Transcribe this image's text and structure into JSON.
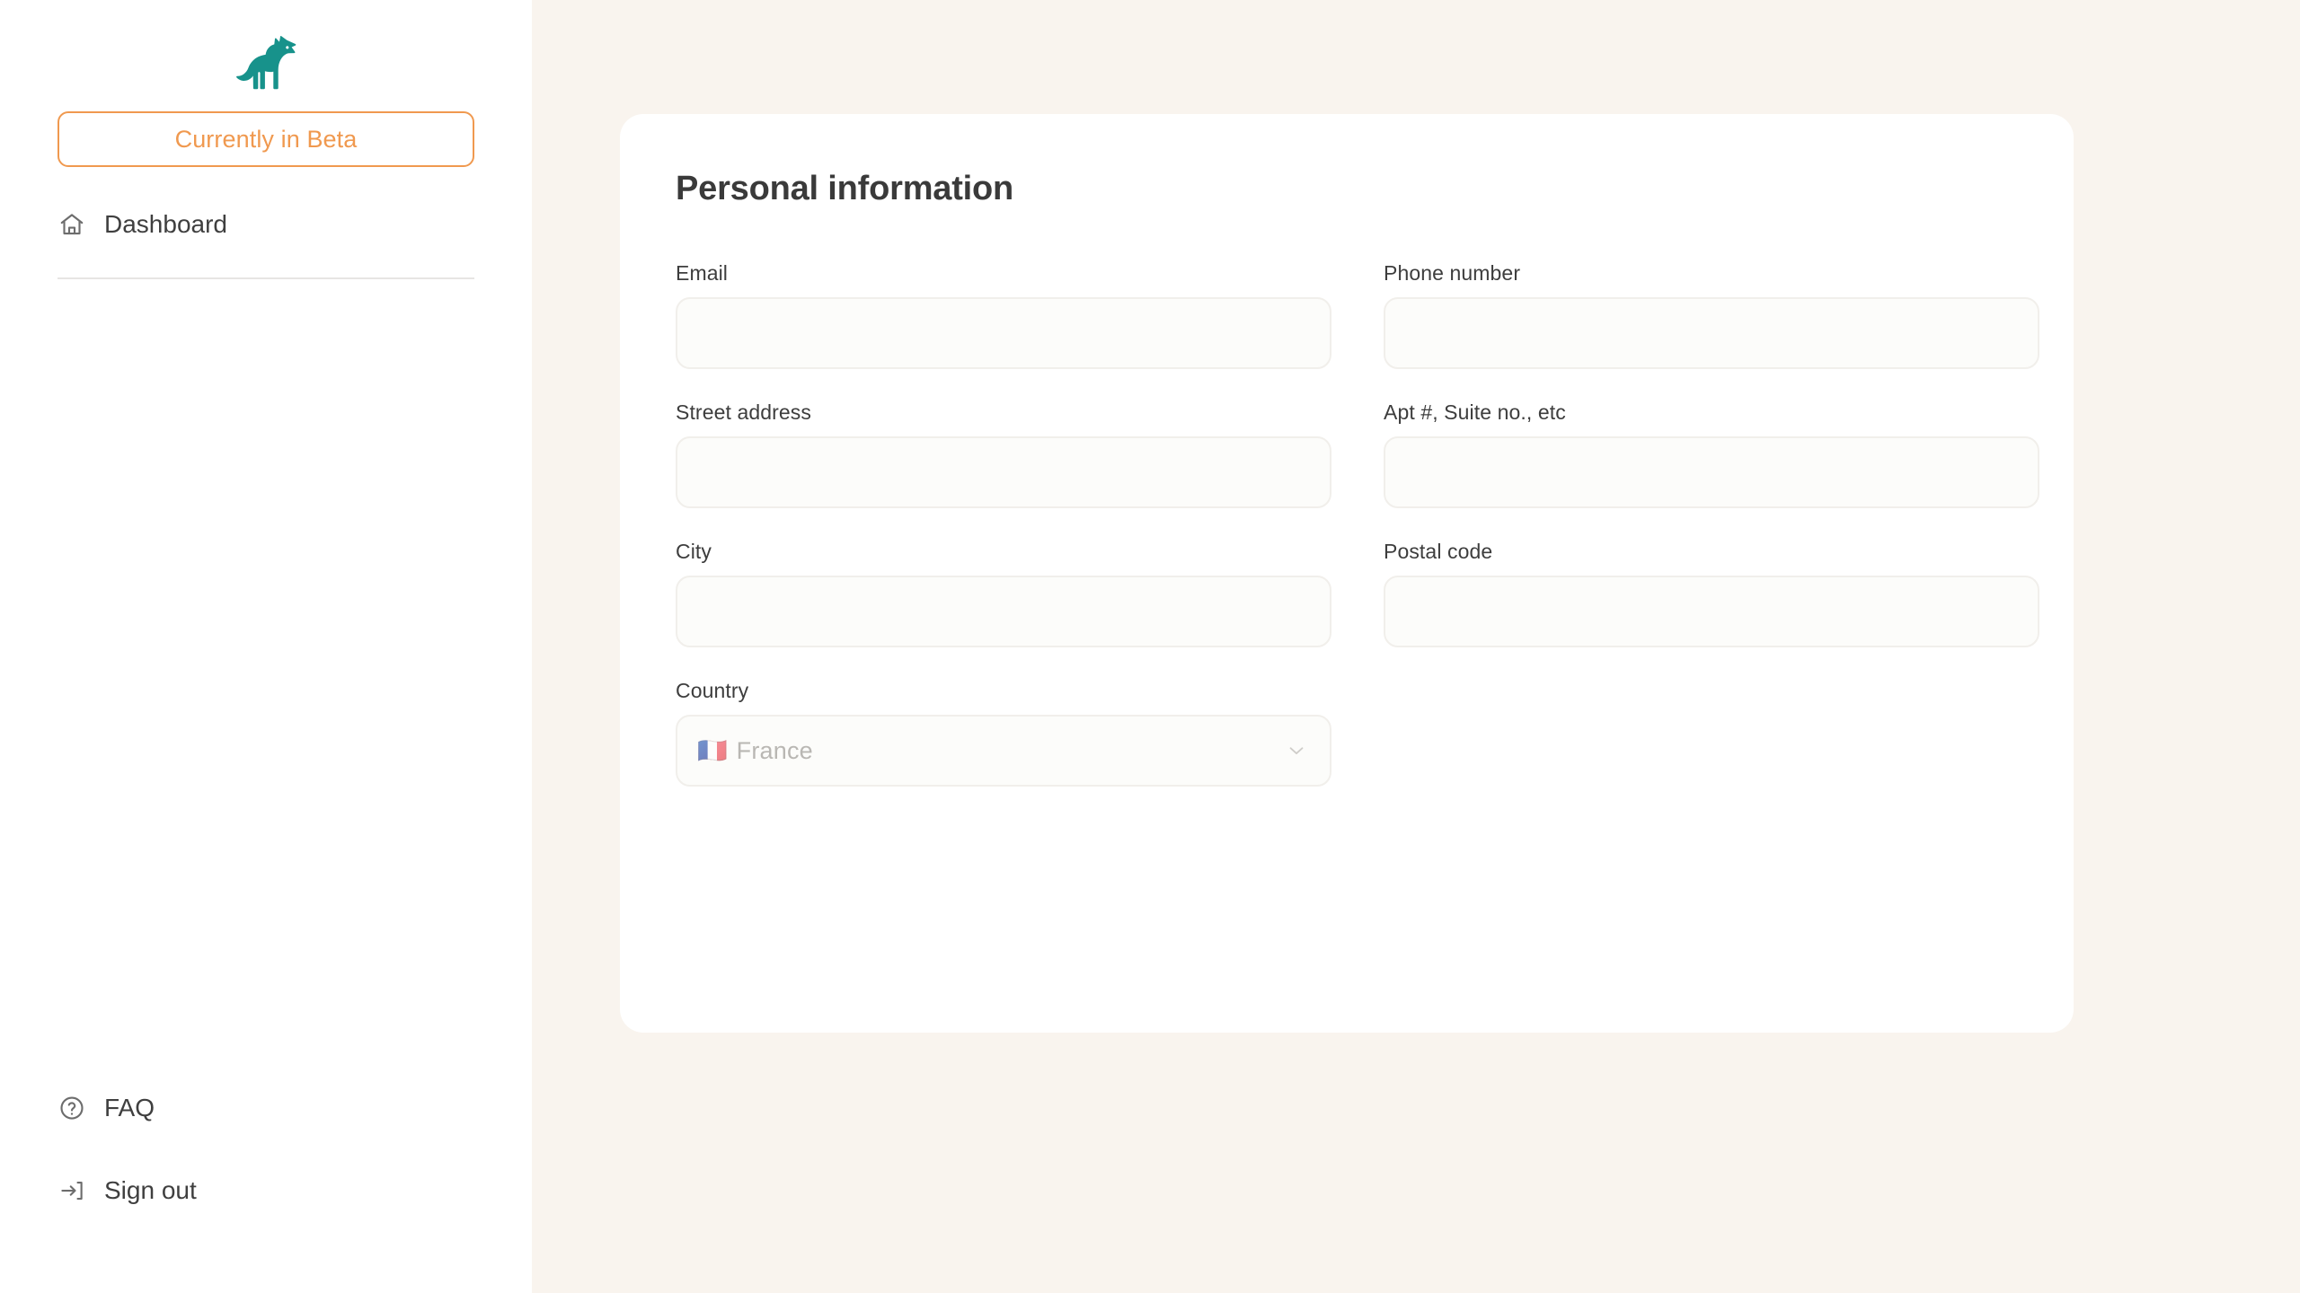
{
  "sidebar": {
    "logo": {
      "icon": "dog-logo-icon",
      "color": "#17928b"
    },
    "beta_badge": {
      "label": "Currently in Beta",
      "color": "#f0994f"
    },
    "top_nav": [
      {
        "id": "dashboard",
        "label": "Dashboard",
        "icon": "home-icon"
      }
    ],
    "bottom_nav": [
      {
        "id": "faq",
        "label": "FAQ",
        "icon": "question-circle-icon"
      },
      {
        "id": "sign-out",
        "label": "Sign out",
        "icon": "sign-out-icon"
      }
    ]
  },
  "main": {
    "card": {
      "title": "Personal information",
      "fields": [
        {
          "id": "email",
          "label": "Email",
          "value": "",
          "placeholder": "",
          "type": "text"
        },
        {
          "id": "phone-number",
          "label": "Phone number",
          "value": "",
          "placeholder": "",
          "type": "text"
        },
        {
          "id": "street-address",
          "label": "Street address",
          "value": "",
          "placeholder": "",
          "type": "text"
        },
        {
          "id": "apt-suite",
          "label": "Apt #, Suite no., etc",
          "value": "",
          "placeholder": "",
          "type": "text"
        },
        {
          "id": "city",
          "label": "City",
          "value": "",
          "placeholder": "",
          "type": "text"
        },
        {
          "id": "postal-code",
          "label": "Postal code",
          "value": "",
          "placeholder": "",
          "type": "text"
        }
      ],
      "country_field": {
        "id": "country",
        "label": "Country",
        "flag": "🇫🇷",
        "value": "France",
        "chevron": "chevron-down-icon"
      }
    }
  },
  "colors": {
    "page_background": "#f9f4ee",
    "sidebar_background": "#ffffff",
    "card_background": "#ffffff",
    "accent_orange": "#f0994f",
    "brand_teal": "#17928b",
    "input_background": "#fcfcfa",
    "input_border": "#f1efeb",
    "text_dark": "#3a3a3a"
  }
}
